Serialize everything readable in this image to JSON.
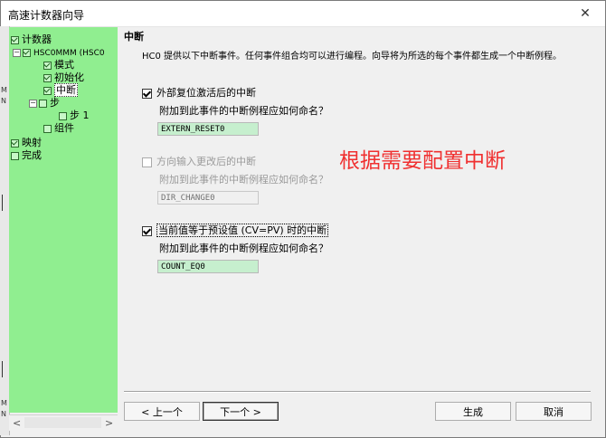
{
  "window": {
    "title": "高速计数器向导",
    "close_glyph": "✕"
  },
  "edge_marks": [
    "M",
    "N",
    "M",
    "N"
  ],
  "tree": {
    "items": [
      {
        "id": "counter",
        "label": "计数器",
        "checked": true
      },
      {
        "id": "hsc",
        "label": "HSC0MMM (HSC0",
        "checked": true
      },
      {
        "id": "mode",
        "label": "模式",
        "checked": true
      },
      {
        "id": "init",
        "label": "初始化",
        "checked": true
      },
      {
        "id": "interrupt",
        "label": "中断",
        "checked": true,
        "selected": true
      },
      {
        "id": "step",
        "label": "步",
        "checked": false
      },
      {
        "id": "step1",
        "label": "步 1",
        "checked": false
      },
      {
        "id": "component",
        "label": "组件",
        "checked": false
      },
      {
        "id": "map",
        "label": "映射",
        "checked": true
      },
      {
        "id": "done",
        "label": "完成",
        "checked": false
      }
    ],
    "expand_glyph": "−",
    "scroll_left": "<",
    "scroll_right": ">"
  },
  "panel": {
    "heading": "中断",
    "description": "HC0 提供以下中断事件。任何事件组合均可以进行编程。向导将为所选的每个事件都生成一个中断例程。",
    "events": [
      {
        "label": "外部复位激活后的中断",
        "checked": true,
        "enabled": true,
        "question": "附加到此事件的中断例程应如何命名？",
        "value": "EXTERN_RESET0"
      },
      {
        "label": "方向输入更改后的中断",
        "checked": false,
        "enabled": false,
        "question": "附加到此事件的中断例程应如何命名？",
        "value": "DIR_CHANGE0"
      },
      {
        "label": "当前值等于预设值 (CV=PV) 时的中断",
        "checked": true,
        "enabled": true,
        "question": "附加到此事件的中断例程应如何命名？",
        "value": "COUNT_EQ0"
      }
    ],
    "annotation": "根据需要配置中断"
  },
  "buttons": {
    "prev": "< 上一个",
    "next": "下一个 >",
    "finish": "生成",
    "cancel": "取消"
  }
}
